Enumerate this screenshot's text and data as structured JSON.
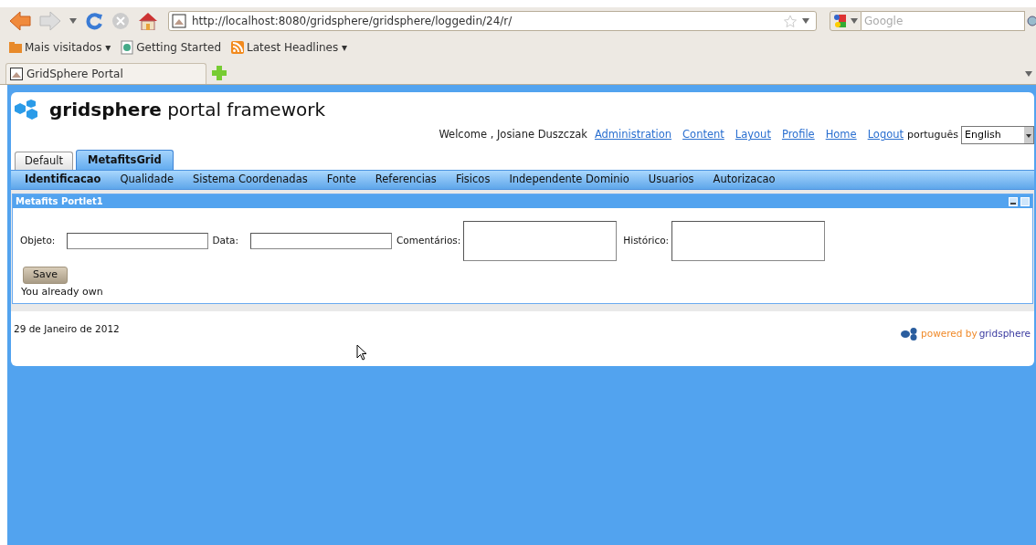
{
  "browser": {
    "url": "http://localhost:8080/gridsphere/gridsphere/loggedin/24/r/",
    "search_placeholder": "Google",
    "bookmarks": [
      {
        "label": "Mais visitados ▾",
        "kind": "folder"
      },
      {
        "label": "Getting Started",
        "kind": "page"
      },
      {
        "label": "Latest Headlines ▾",
        "kind": "feed"
      }
    ],
    "tab_title": "GridSphere Portal"
  },
  "portal": {
    "logo": "**gridsphere** portal framework",
    "welcome": "Welcome , Josiane Duszczak",
    "links": [
      "Administration",
      "Content",
      "Layout",
      "Profile",
      "Home",
      "Logout"
    ],
    "language_label": "português",
    "language_value": "English",
    "tabs": [
      {
        "label": "Default",
        "selected": false
      },
      {
        "label": "MetafitsGrid",
        "selected": true
      }
    ],
    "subtabs": [
      {
        "label": "Identificacao",
        "selected": true
      },
      {
        "label": "Qualidade",
        "selected": false
      },
      {
        "label": "Sistema Coordenadas",
        "selected": false
      },
      {
        "label": "Fonte",
        "selected": false
      },
      {
        "label": "Referencias",
        "selected": false
      },
      {
        "label": "Fisicos",
        "selected": false
      },
      {
        "label": "Independente Dominio",
        "selected": false
      },
      {
        "label": "Usuarios",
        "selected": false
      },
      {
        "label": "Autorizacao",
        "selected": false
      }
    ],
    "portlet": {
      "title": "Metafits Portlet1",
      "fields": [
        {
          "label": "Objeto:",
          "kind": "input"
        },
        {
          "label": "Data:",
          "kind": "input"
        },
        {
          "label": "Comentários:",
          "kind": "textarea"
        },
        {
          "label": "Histórico:",
          "kind": "textarea"
        }
      ],
      "save": "Save",
      "message": "You already own"
    },
    "date": "29 de Janeiro de 2012",
    "powered_prefix": "powered by",
    "powered_brand": "gridsphere"
  }
}
